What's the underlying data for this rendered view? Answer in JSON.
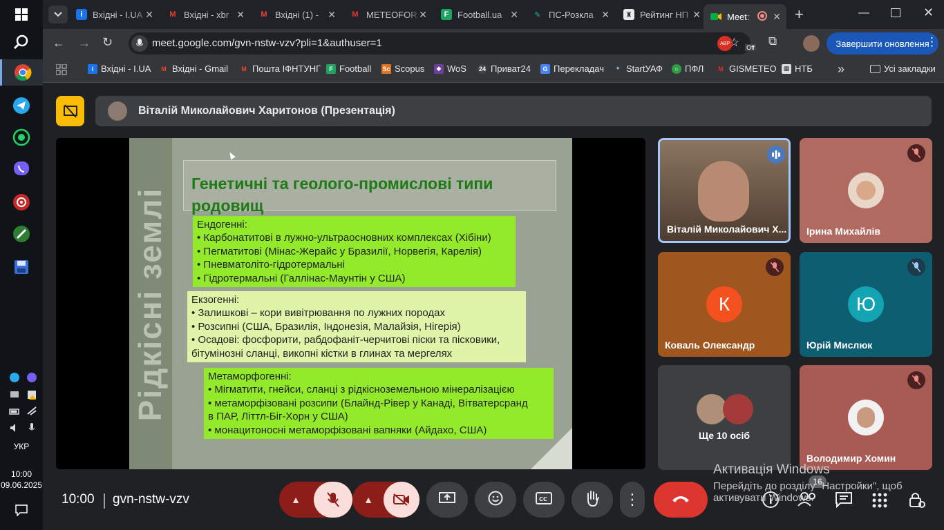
{
  "browser": {
    "tabs": [
      {
        "label": "Вхідні - I.UA",
        "icon": "iua-icon"
      },
      {
        "label": "Вхідні - xbr",
        "icon": "gmail-icon"
      },
      {
        "label": "Вхідні (1) -",
        "icon": "gmail-icon"
      },
      {
        "label": "METEOFOR",
        "icon": "meteofor-icon"
      },
      {
        "label": "Football.ua",
        "icon": "football-icon"
      },
      {
        "label": "ПС-Розкла",
        "icon": "feather-icon"
      },
      {
        "label": "Рейтинг НП",
        "icon": "crest-icon"
      },
      {
        "label": "Meet: ",
        "icon": "meet-icon"
      }
    ],
    "url": "meet.google.com/gvn-nstw-vzv?pli=1&authuser=1",
    "update_button": "Завершити оновлення",
    "bookmarks": [
      {
        "label": "Вхідні - I.UA",
        "color": "#1a73e8"
      },
      {
        "label": "Вхідні - Gmail",
        "color": "#ea4335"
      },
      {
        "label": "Пошта ІФНТУНГ",
        "color": "#ea4335"
      },
      {
        "label": "Football",
        "color": "#1ea362"
      },
      {
        "label": "Scopus",
        "color": "#e9711c"
      },
      {
        "label": "WoS",
        "color": "#6b3fa0"
      },
      {
        "label": "Приват24",
        "color": "#444"
      },
      {
        "label": "Перекладач",
        "color": "#4285f4"
      },
      {
        "label": "StartУАФ",
        "color": "#3367d6"
      },
      {
        "label": "ПФЛ",
        "color": "#2e9e44"
      },
      {
        "label": "GISMETEO",
        "color": "#d93025"
      },
      {
        "label": "НТБ",
        "color": "#666"
      }
    ],
    "all_bookmarks": "Усі закладки"
  },
  "meet": {
    "presenter": "Віталій Миколайович Харитонов (Презентація)",
    "slide": {
      "vertical_title": "Рідкісні землі",
      "title": "Генетичні та геолого-промислові типи родовищ",
      "blocks": [
        {
          "lines": [
            "Ендогенні:",
            "• Карбонатитові в лужно-ультраосновних комплексах (Хібіни)",
            "• Пегматитові (Мінас-Жерайс у Бразилії, Норвегія, Карелія)",
            "• Пневматоліто-гідротермальні",
            "• Гідротермальні (Галлінас-Маунтін у США)"
          ]
        },
        {
          "lines": [
            "Екзогенні:",
            "• Залишкові – кори вивітрювання по лужних породах",
            "• Розсипні (США, Бразилія, Індонезія, Малайзія, Нігерія)",
            "• Осадові: фосфорити, рабдофаніт-черчитові піски та пісковики,",
            "бітумінозні сланці, викопні кістки в глинах та мергелях"
          ]
        },
        {
          "lines": [
            "Метаморфогенні:",
            "• Мігматити, гнейси, сланці з рідкісноземельною мінералізацією",
            "• метаморфізовані розсипи (Блайнд-Рівер у Канаді, Вітватерсранд",
            "в ПАР, Літтл-Біг-Хорн у США)",
            "• монацитоносні метаморфізовані вапняки (Айдахо, США)"
          ]
        }
      ]
    },
    "participants": [
      {
        "name": "Віталій Миколайович Х...",
        "initial": ""
      },
      {
        "name": "Ірина Михайлів",
        "initial": ""
      },
      {
        "name": "Коваль Олександр",
        "initial": "К"
      },
      {
        "name": "Юрій Мислюк",
        "initial": "Ю"
      },
      {
        "name": "Ще 10 осіб",
        "initial": ""
      },
      {
        "name": "Володимир Хомин",
        "initial": ""
      }
    ],
    "clock": "10:00",
    "code": "gvn-nstw-vzv",
    "people_count": "16"
  },
  "taskbar": {
    "lang": "УКР",
    "time": "10:00",
    "date": "09.06.2025"
  },
  "watermark": {
    "title": "Активація Windows",
    "line1": "Перейдіть до розділу \"Настройки\", щоб",
    "line2": "активувати Windows."
  }
}
